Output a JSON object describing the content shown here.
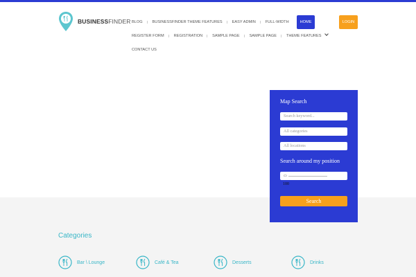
{
  "logo": {
    "bold": "BUSINESS",
    "light": "FINDER",
    "icon": "map-pin-icon"
  },
  "nav": {
    "row1": [
      "BLOG",
      "BUSINESSFINDER THEME FEATURES",
      "EASY ADMIN",
      "FULL-WIDTH"
    ],
    "active": "HOME",
    "row2": [
      "REGISTER FORM",
      "REGISTRATION",
      "SAMPLE PAGE",
      "SAMPLE PAGE",
      "THEME FEATURES"
    ],
    "row3": [
      "CONTACT US"
    ],
    "dropdown_icon": "chevron-down-icon"
  },
  "login_label": "LOGIN",
  "map_search": {
    "title": "Map Search",
    "keyword_placeholder": "Search keyword...",
    "categories_placeholder": "All categories",
    "locations_placeholder": "All locations",
    "around_title": "Search around my position",
    "range_value": "100",
    "search_label": "Search"
  },
  "categories": {
    "title": "Categories",
    "items": [
      {
        "label": "Bar \\ Lounge",
        "icon": "fork-spoon-icon"
      },
      {
        "label": "Café & Tea",
        "icon": "fork-spoon-icon"
      },
      {
        "label": "Desserts",
        "icon": "fork-spoon-icon"
      },
      {
        "label": "Drinks",
        "icon": "fork-spoon-icon"
      }
    ]
  },
  "colors": {
    "primary": "#2b3bd3",
    "accent": "#f7a01d",
    "teal": "#38b6c7"
  }
}
